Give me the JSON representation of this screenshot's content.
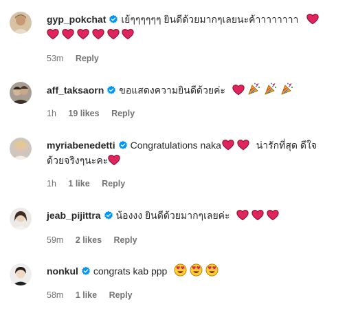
{
  "comments": [
    {
      "username": "gyp_pokchat",
      "text": "เย้ๆๆๆๆๆๆ ยินดีด้วยมากๆเลยนะค้าาาาาาาา",
      "time": "53m",
      "likes": "",
      "reply": "Reply",
      "emojis_inline": [
        "heart"
      ],
      "emojis_line2": [
        "heart",
        "heart",
        "heart",
        "heart",
        "heart",
        "heart"
      ]
    },
    {
      "username": "aff_taksaorn",
      "text": "ขอแสดงความยินดีด้วยค่ะ",
      "time": "1h",
      "likes": "19 likes",
      "reply": "Reply",
      "emojis_inline": [
        "heart",
        "party-popper",
        "party-popper",
        "party-popper"
      ]
    },
    {
      "username": "myriabenedetti",
      "text": "Congratulations naka",
      "text2": "น่ารักที่สุด ดีใจ",
      "text3": "ด้วยจริงๆนะคะ",
      "time": "1h",
      "likes": "1 like",
      "reply": "Reply",
      "emojis_inline": [
        "heart",
        "heart"
      ],
      "emojis_line2": [
        "heart"
      ]
    },
    {
      "username": "jeab_pijittra",
      "text": "น้องงง ยินดีด้วยมากๆเลยค่ะ",
      "time": "59m",
      "likes": "2 likes",
      "reply": "Reply",
      "emojis_inline": [
        "heart",
        "heart",
        "heart"
      ]
    },
    {
      "username": "nonkul",
      "text": "congrats kab ppp",
      "time": "58m",
      "likes": "1 like",
      "reply": "Reply",
      "emojis_inline": [
        "heart-eyes",
        "heart-eyes",
        "heart-eyes"
      ]
    }
  ],
  "colors": {
    "verified": "#0095f6",
    "heart": "#e0245e",
    "meta": "#737373"
  }
}
